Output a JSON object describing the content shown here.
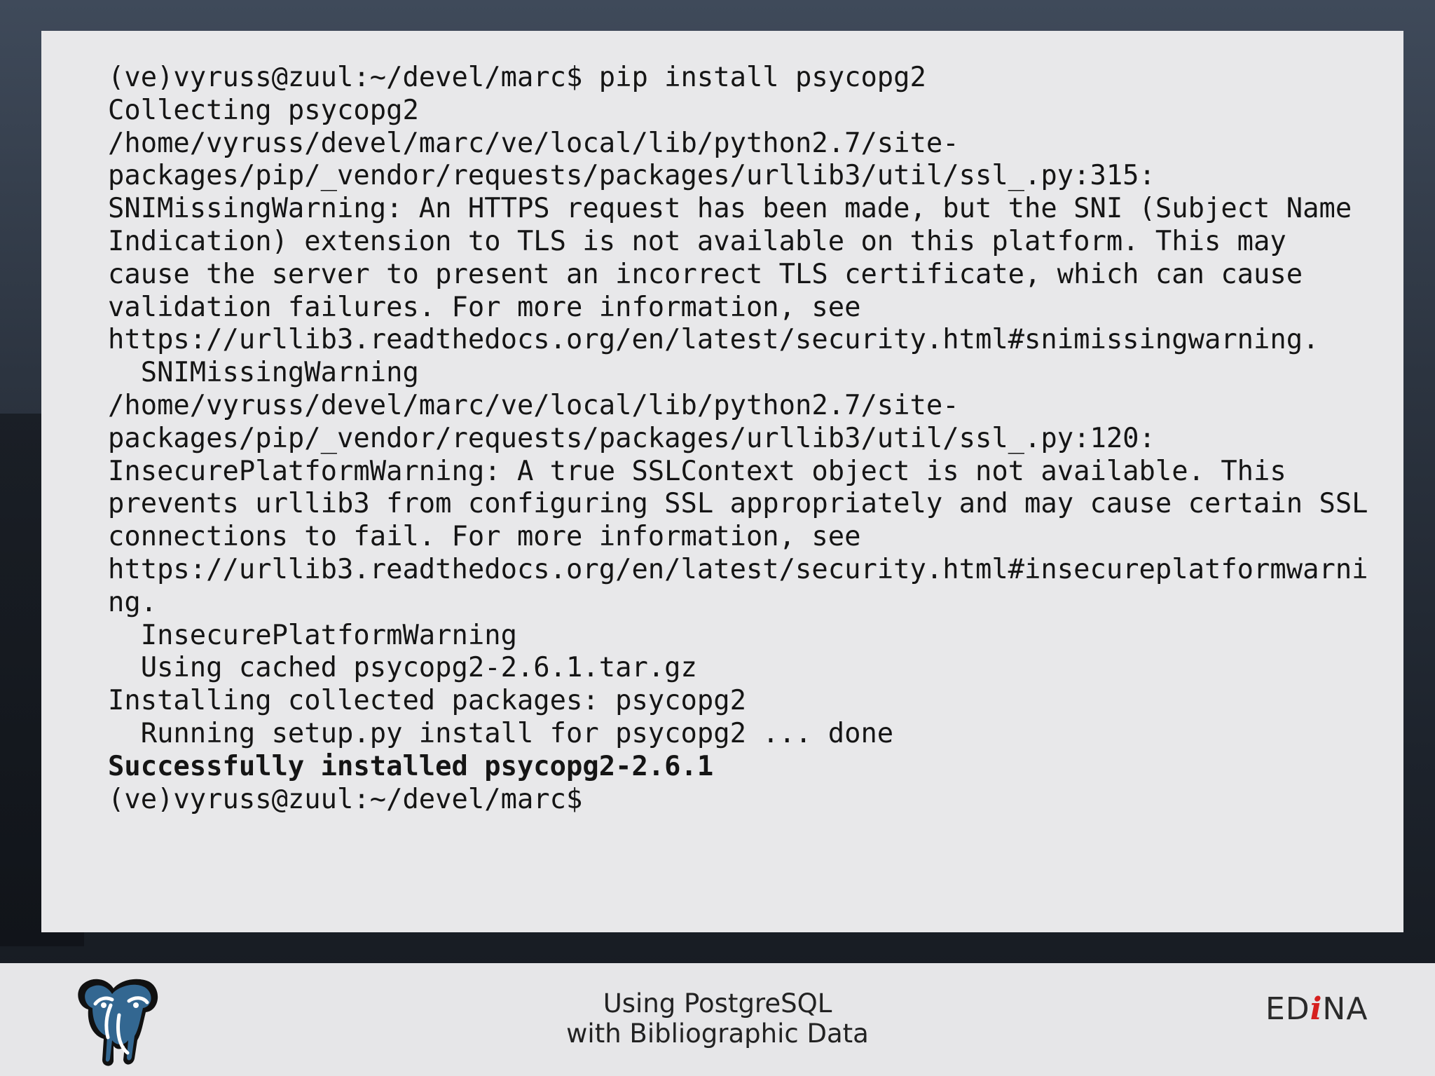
{
  "terminal": {
    "lines": [
      {
        "text": "(ve)vyruss@zuul:~/devel/marc$ pip install psycopg2",
        "bold": true
      },
      {
        "text": "Collecting psycopg2",
        "bold": false
      },
      {
        "text": "/home/vyruss/devel/marc/ve/local/lib/python2.7/site-",
        "bold": false
      },
      {
        "text": "packages/pip/_vendor/requests/packages/urllib3/util/ssl_.py:315:",
        "bold": false
      },
      {
        "text": "SNIMissingWarning: An HTTPS request has been made, but the SNI (Subject Name",
        "bold": false
      },
      {
        "text": "Indication) extension to TLS is not available on this platform. This may",
        "bold": false
      },
      {
        "text": "cause the server to present an incorrect TLS certificate, which can cause",
        "bold": false
      },
      {
        "text": "validation failures. For more information, see",
        "bold": false
      },
      {
        "text": "https://urllib3.readthedocs.org/en/latest/security.html#snimissingwarning.",
        "bold": false
      },
      {
        "text": "  SNIMissingWarning",
        "bold": false
      },
      {
        "text": "/home/vyruss/devel/marc/ve/local/lib/python2.7/site-",
        "bold": false
      },
      {
        "text": "packages/pip/_vendor/requests/packages/urllib3/util/ssl_.py:120:",
        "bold": false
      },
      {
        "text": "InsecurePlatformWarning: A true SSLContext object is not available. This",
        "bold": false
      },
      {
        "text": "prevents urllib3 from configuring SSL appropriately and may cause certain SSL",
        "bold": false
      },
      {
        "text": "connections to fail. For more information, see",
        "bold": false
      },
      {
        "text": "https://urllib3.readthedocs.org/en/latest/security.html#insecureplatformwarni",
        "bold": false
      },
      {
        "text": "ng.",
        "bold": false
      },
      {
        "text": "  InsecurePlatformWarning",
        "bold": false
      },
      {
        "text": "  Using cached psycopg2-2.6.1.tar.gz",
        "bold": false
      },
      {
        "text": "Installing collected packages: psycopg2",
        "bold": false
      },
      {
        "text": "  Running setup.py install for psycopg2 ... done",
        "bold": false
      },
      {
        "text": "Successfully installed psycopg2-2.6.1",
        "bold": true
      },
      {
        "text": "(ve)vyruss@zuul:~/devel/marc$",
        "bold": false
      }
    ]
  },
  "footer": {
    "title_line_1": "Using PostgreSQL",
    "title_line_2": "with Bibliographic Data",
    "left_logo_icon": "postgresql-elephant-icon",
    "right_logo": {
      "prefix": "ED",
      "accent": "i",
      "suffix": "NA"
    }
  },
  "colors": {
    "panel_background": "#e8e8ea",
    "footer_background": "#e6e6e8",
    "text": "#151515",
    "postgres_blue": "#336791",
    "edina_red": "#d6201f"
  }
}
